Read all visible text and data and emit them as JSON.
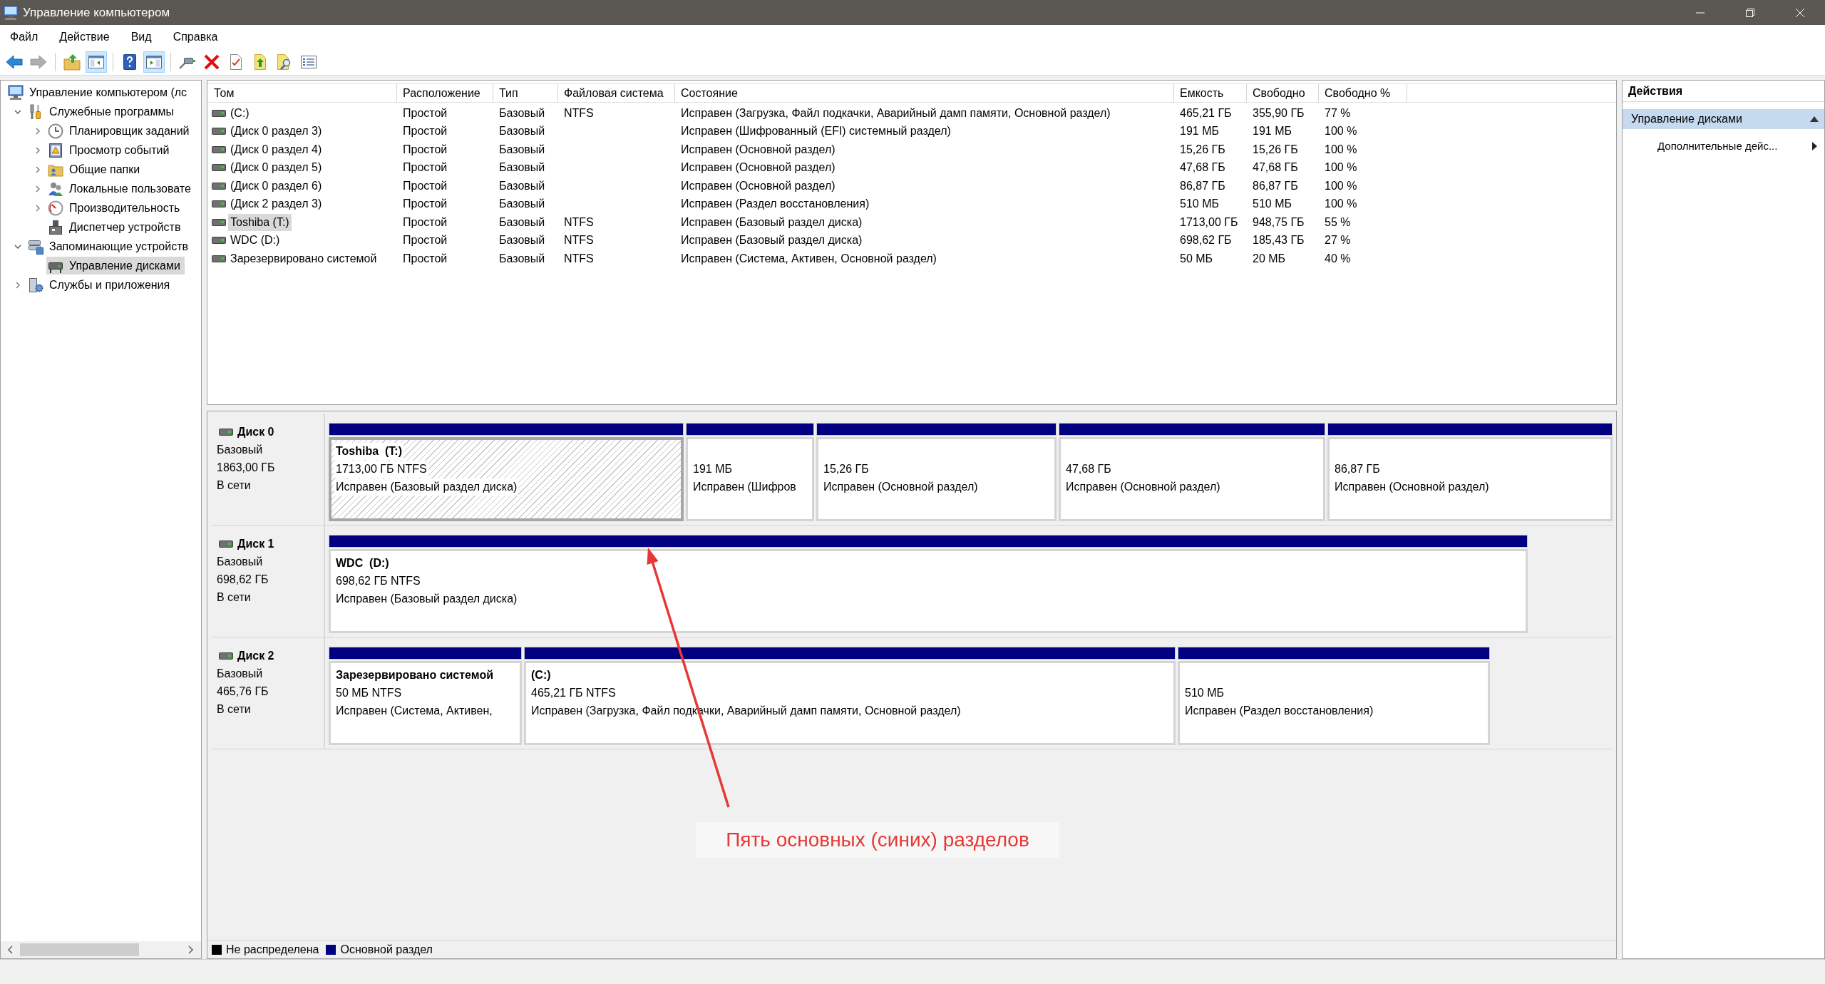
{
  "window": {
    "title": "Управление компьютером"
  },
  "menu": [
    {
      "label": "Файл"
    },
    {
      "label": "Действие"
    },
    {
      "label": "Вид"
    },
    {
      "label": "Справка"
    }
  ],
  "toolbar": [
    [
      {
        "kind": "back",
        "pressed": false,
        "disabled": false
      },
      {
        "kind": "forward",
        "pressed": false,
        "disabled": true
      }
    ],
    [
      {
        "kind": "folder-up",
        "pressed": false,
        "disabled": false
      },
      {
        "kind": "tree-pane",
        "pressed": true,
        "disabled": false
      }
    ],
    [
      {
        "kind": "help",
        "pressed": false,
        "disabled": false
      },
      {
        "kind": "action-pane",
        "pressed": true,
        "disabled": false
      }
    ],
    [
      {
        "kind": "connect",
        "pressed": false,
        "disabled": false
      },
      {
        "kind": "delete",
        "pressed": false,
        "disabled": false
      },
      {
        "kind": "properties",
        "pressed": false,
        "disabled": false
      },
      {
        "kind": "export",
        "pressed": false,
        "disabled": false
      },
      {
        "kind": "find",
        "pressed": false,
        "disabled": false
      },
      {
        "kind": "list",
        "pressed": false,
        "disabled": false
      }
    ]
  ],
  "tree": [
    {
      "label": "Управление компьютером (лс",
      "kind": "computer",
      "selected": false,
      "children": [
        {
          "label": "Служебные программы",
          "kind": "tools",
          "expanded": true,
          "selected": false,
          "children": [
            {
              "label": "Планировщик заданий",
              "kind": "clock",
              "expanded": false,
              "selected": false
            },
            {
              "label": "Просмотр событий",
              "kind": "event-log",
              "expanded": false,
              "selected": false
            },
            {
              "label": "Общие папки",
              "kind": "shared-folder",
              "expanded": false,
              "selected": false
            },
            {
              "label": "Локальные пользовате",
              "kind": "users",
              "expanded": false,
              "selected": false
            },
            {
              "label": "Производительность",
              "kind": "performance",
              "expanded": false,
              "selected": false
            },
            {
              "label": "Диспетчер устройств",
              "kind": "devices",
              "selected": false
            }
          ]
        },
        {
          "label": "Запоминающие устройств",
          "kind": "storage",
          "expanded": true,
          "selected": false,
          "children": [
            {
              "label": "Управление дисками",
              "kind": "disk-management",
              "selected": true
            }
          ]
        },
        {
          "label": "Службы и приложения",
          "kind": "services",
          "expanded": false,
          "selected": false
        }
      ]
    }
  ],
  "volume_list": {
    "columns": [
      "Том",
      "Расположение",
      "Тип",
      "Файловая система",
      "Состояние",
      "Емкость",
      "Свободно",
      "Свободно %"
    ],
    "rows": [
      {
        "volume": "(C:)",
        "layout": "Простой",
        "type": "Базовый",
        "file_system": "NTFS",
        "status": "Исправен (Загрузка, Файл подкачки, Аварийный дамп памяти, Основной раздел)",
        "capacity": "465,21 ГБ",
        "free": "355,90 ГБ",
        "free_percent": "77 %",
        "selected": false
      },
      {
        "volume": "(Диск 0 раздел 3)",
        "layout": "Простой",
        "type": "Базовый",
        "status": "Исправен (Шифрованный (EFI) системный раздел)",
        "capacity": "191 МБ",
        "free": "191 МБ",
        "free_percent": "100 %",
        "selected": false
      },
      {
        "volume": "(Диск 0 раздел 4)",
        "layout": "Простой",
        "type": "Базовый",
        "status": "Исправен (Основной раздел)",
        "capacity": "15,26 ГБ",
        "free": "15,26 ГБ",
        "free_percent": "100 %",
        "selected": false
      },
      {
        "volume": "(Диск 0 раздел 5)",
        "layout": "Простой",
        "type": "Базовый",
        "status": "Исправен (Основной раздел)",
        "capacity": "47,68 ГБ",
        "free": "47,68 ГБ",
        "free_percent": "100 %",
        "selected": false
      },
      {
        "volume": "(Диск 0 раздел 6)",
        "layout": "Простой",
        "type": "Базовый",
        "status": "Исправен (Основной раздел)",
        "capacity": "86,87 ГБ",
        "free": "86,87 ГБ",
        "free_percent": "100 %",
        "selected": false
      },
      {
        "volume": "(Диск 2 раздел 3)",
        "layout": "Простой",
        "type": "Базовый",
        "status": "Исправен (Раздел восстановления)",
        "capacity": "510 МБ",
        "free": "510 МБ",
        "free_percent": "100 %",
        "selected": false
      },
      {
        "volume": "Toshiba (T:)",
        "layout": "Простой",
        "type": "Базовый",
        "file_system": "NTFS",
        "status": "Исправен (Базовый раздел диска)",
        "capacity": "1713,00 ГБ",
        "free": "948,75 ГБ",
        "free_percent": "55 %",
        "selected": true
      },
      {
        "volume": "WDC (D:)",
        "layout": "Простой",
        "type": "Базовый",
        "file_system": "NTFS",
        "status": "Исправен (Базовый раздел диска)",
        "capacity": "698,62 ГБ",
        "free": "185,43 ГБ",
        "free_percent": "27 %",
        "selected": false
      },
      {
        "volume": "Зарезервировано системой",
        "layout": "Простой",
        "type": "Базовый",
        "file_system": "NTFS",
        "status": "Исправен (Система, Активен, Основной раздел)",
        "capacity": "50 МБ",
        "free": "20 МБ",
        "free_percent": "40 %",
        "selected": false
      }
    ]
  },
  "disks": [
    {
      "name": "Диск 0",
      "type": "Базовый",
      "size": "1863,00 ГБ",
      "status": "В сети",
      "partitions": [
        {
          "label": "Toshiba  (T:)",
          "size": "1713,00 ГБ NTFS",
          "status": "Исправен (Базовый раздел диска)",
          "color": "#000080",
          "selected": true
        },
        {
          "size": "191 МБ",
          "status": "Исправен (Шифров",
          "color": "#000080",
          "selected": false
        },
        {
          "size": "15,26 ГБ",
          "status": "Исправен (Основной раздел)",
          "color": "#000080",
          "selected": false
        },
        {
          "size": "47,68 ГБ",
          "status": "Исправен (Основной раздел)",
          "color": "#000080",
          "selected": false
        },
        {
          "size": "86,87 ГБ",
          "status": "Исправен (Основной раздел)",
          "color": "#000080",
          "selected": false
        }
      ]
    },
    {
      "name": "Диск 1",
      "type": "Базовый",
      "size": "698,62 ГБ",
      "status": "В сети",
      "partitions": [
        {
          "label": "WDC  (D:)",
          "size": "698,62 ГБ NTFS",
          "status": "Исправен (Базовый раздел диска)",
          "color": "#000080",
          "selected": false
        }
      ]
    },
    {
      "name": "Диск 2",
      "type": "Базовый",
      "size": "465,76 ГБ",
      "status": "В сети",
      "partitions": [
        {
          "label": "Зарезервировано системой",
          "size": "50 МБ NTFS",
          "status": "Исправен (Система, Активен,",
          "color": "#000080",
          "selected": false
        },
        {
          "label": "(C:)",
          "size": "465,21 ГБ NTFS",
          "status": "Исправен (Загрузка, Файл подкачки, Аварийный дамп памяти, Основной раздел)",
          "color": "#000080",
          "selected": false
        },
        {
          "size": "510 МБ",
          "status": "Исправен (Раздел восстановления)",
          "color": "#000080",
          "selected": false
        }
      ]
    }
  ],
  "legend": [
    {
      "label": "Не распределена",
      "color": "#000000"
    },
    {
      "label": "Основной раздел",
      "color": "#000080"
    }
  ],
  "actions": {
    "title": "Действия",
    "sections": [
      {
        "label": "Управление дисками",
        "expanded": true,
        "items": [
          {
            "label": "Дополнительные дейс..."
          }
        ]
      }
    ]
  },
  "annotation": {
    "text": "Пять основных (синих) разделов"
  }
}
